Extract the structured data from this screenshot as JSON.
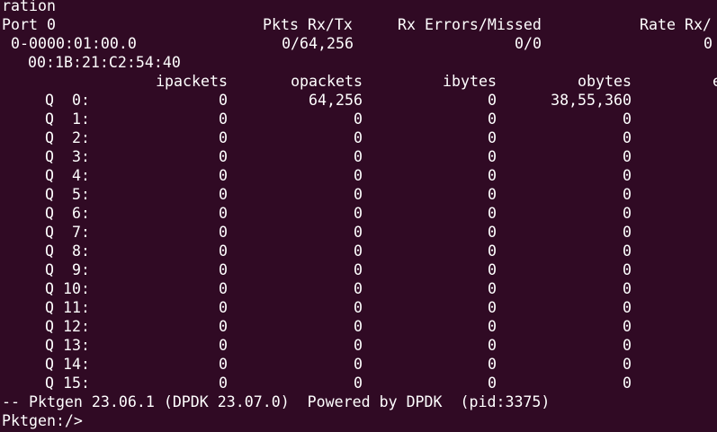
{
  "screen": {
    "line0": "ration",
    "port_header": {
      "port": "Port 0",
      "pkts": "Pkts Rx/Tx",
      "errors": "Rx Errors/Missed",
      "rate": "Rate Rx/"
    },
    "port_row": {
      "pci": " 0-0000:01:00.0",
      "pkts": "0/64,256",
      "errors": "0/0",
      "rate": "0"
    },
    "mac": "00:1B:21:C2:54:40",
    "queue_headers": [
      "ipackets",
      "opackets",
      "ibytes",
      "obytes",
      "e"
    ],
    "queues": [
      {
        "label": "Q  0:",
        "ipackets": "0",
        "opackets": "64,256",
        "ibytes": "0",
        "obytes": "38,55,360"
      },
      {
        "label": "Q  1:",
        "ipackets": "0",
        "opackets": "0",
        "ibytes": "0",
        "obytes": "0"
      },
      {
        "label": "Q  2:",
        "ipackets": "0",
        "opackets": "0",
        "ibytes": "0",
        "obytes": "0"
      },
      {
        "label": "Q  3:",
        "ipackets": "0",
        "opackets": "0",
        "ibytes": "0",
        "obytes": "0"
      },
      {
        "label": "Q  4:",
        "ipackets": "0",
        "opackets": "0",
        "ibytes": "0",
        "obytes": "0"
      },
      {
        "label": "Q  5:",
        "ipackets": "0",
        "opackets": "0",
        "ibytes": "0",
        "obytes": "0"
      },
      {
        "label": "Q  6:",
        "ipackets": "0",
        "opackets": "0",
        "ibytes": "0",
        "obytes": "0"
      },
      {
        "label": "Q  7:",
        "ipackets": "0",
        "opackets": "0",
        "ibytes": "0",
        "obytes": "0"
      },
      {
        "label": "Q  8:",
        "ipackets": "0",
        "opackets": "0",
        "ibytes": "0",
        "obytes": "0"
      },
      {
        "label": "Q  9:",
        "ipackets": "0",
        "opackets": "0",
        "ibytes": "0",
        "obytes": "0"
      },
      {
        "label": "Q 10:",
        "ipackets": "0",
        "opackets": "0",
        "ibytes": "0",
        "obytes": "0"
      },
      {
        "label": "Q 11:",
        "ipackets": "0",
        "opackets": "0",
        "ibytes": "0",
        "obytes": "0"
      },
      {
        "label": "Q 12:",
        "ipackets": "0",
        "opackets": "0",
        "ibytes": "0",
        "obytes": "0"
      },
      {
        "label": "Q 13:",
        "ipackets": "0",
        "opackets": "0",
        "ibytes": "0",
        "obytes": "0"
      },
      {
        "label": "Q 14:",
        "ipackets": "0",
        "opackets": "0",
        "ibytes": "0",
        "obytes": "0"
      },
      {
        "label": "Q 15:",
        "ipackets": "0",
        "opackets": "0",
        "ibytes": "0",
        "obytes": "0"
      }
    ],
    "footer": "-- Pktgen 23.06.1 (DPDK 23.07.0)  Powered by DPDK  (pid:3375)",
    "prompt": "Pktgen:/>"
  },
  "colors": {
    "background": "#300a24",
    "text": "#ffffff"
  }
}
